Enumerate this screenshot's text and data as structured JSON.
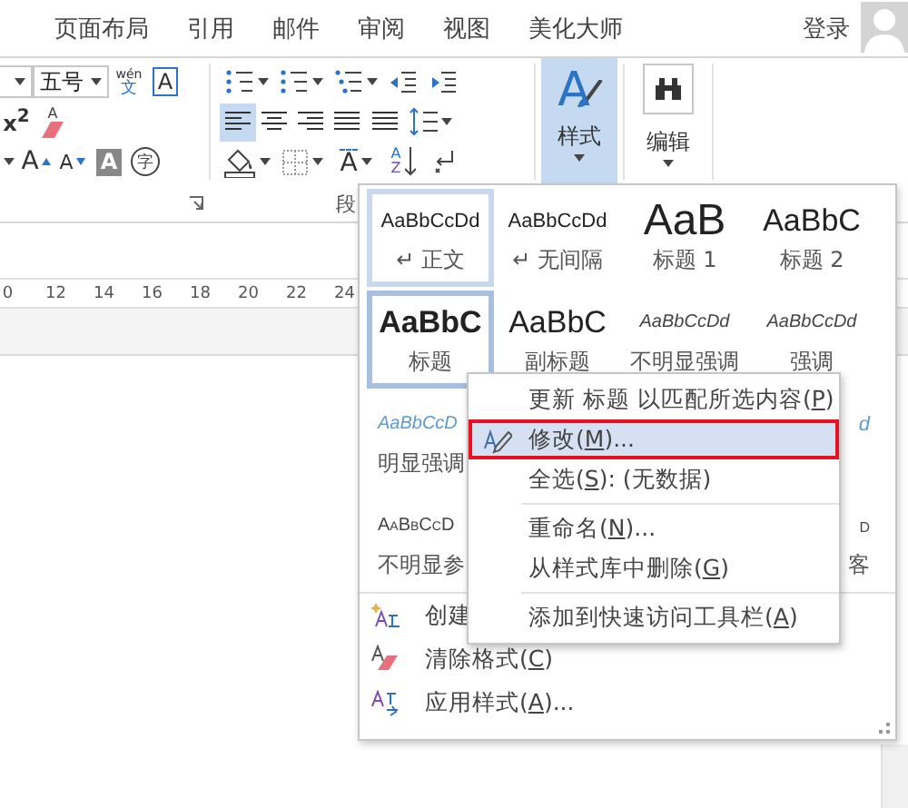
{
  "tabs": [
    {
      "label": "页面布局",
      "selected": false
    },
    {
      "label": "引用",
      "selected": false
    },
    {
      "label": "邮件",
      "selected": false
    },
    {
      "label": "审阅",
      "selected": false
    },
    {
      "label": "视图",
      "selected": false
    },
    {
      "label": "美化大师",
      "selected": false
    }
  ],
  "account": {
    "label": "登录"
  },
  "font_group": {
    "rows": [
      [
        {
          "kind": "combo-stub"
        },
        {
          "kind": "combo",
          "value": "五号"
        },
        {
          "kind": "phonetic",
          "top": "wén",
          "glyph": "文"
        },
        {
          "kind": "char-border",
          "glyph": "A"
        }
      ],
      [
        {
          "kind": "superscript",
          "glyph": "x$^{2}$"
        },
        {
          "kind": "clear-format",
          "glyph": "A"
        }
      ],
      [
        {
          "kind": "caret-stub"
        },
        {
          "kind": "grow-font",
          "glyph": "A"
        },
        {
          "kind": "shrink-font",
          "glyph": "A"
        },
        {
          "kind": "char-shading",
          "glyph": "A"
        },
        {
          "kind": "enclose",
          "glyph": "字"
        }
      ]
    ]
  },
  "paragraph_group": {
    "rows": [
      [
        {
          "kind": "bullets"
        },
        {
          "kind": "numbering"
        },
        {
          "kind": "multilevel"
        },
        {
          "kind": "decrease-indent"
        },
        {
          "kind": "increase-indent"
        }
      ],
      [
        {
          "kind": "align-left",
          "selected": true
        },
        {
          "kind": "align-center",
          "selected": false
        },
        {
          "kind": "align-right",
          "selected": false
        },
        {
          "kind": "justify",
          "selected": false
        },
        {
          "kind": "distribute",
          "selected": false
        },
        {
          "kind": "line-spacing"
        }
      ],
      [
        {
          "kind": "shading"
        },
        {
          "kind": "borders"
        },
        {
          "kind": "asian-layout",
          "glyph": "A"
        },
        {
          "kind": "sort",
          "glyph": "A",
          "glyph2": "Z"
        },
        {
          "kind": "show-marks"
        }
      ]
    ],
    "label": "段"
  },
  "styles_button": {
    "label": "样式",
    "glyph": "A",
    "selected": true
  },
  "editing_button": {
    "label": "编辑"
  },
  "ruler": [
    "0",
    "12",
    "14",
    "16",
    "18",
    "20",
    "22",
    "24"
  ],
  "gallery": {
    "rows": [
      [
        {
          "kind": "normal",
          "preview": "AaBbCcDd",
          "label": "↵ 正文",
          "selected": false,
          "highlighted": true
        },
        {
          "kind": "normal",
          "preview": "AaBbCcDd",
          "label": "↵ 无间隔",
          "selected": false,
          "highlighted": false
        },
        {
          "kind": "heading1",
          "preview": "AaB",
          "label": "标题 1",
          "selected": false,
          "highlighted": false
        },
        {
          "kind": "heading2",
          "preview": "AaBbC",
          "label": "标题 2",
          "selected": false,
          "highlighted": false
        }
      ],
      [
        {
          "kind": "title",
          "preview": "AaBbC",
          "label": "标题",
          "selected": true,
          "highlighted": false
        },
        {
          "kind": "subtitle",
          "preview": "AaBbC",
          "label": "副标题",
          "selected": false,
          "highlighted": false
        },
        {
          "kind": "subtle",
          "preview": "AaBbCcDd",
          "label": "不明显强调",
          "selected": false,
          "highlighted": false
        },
        {
          "kind": "emphasis",
          "preview": "AaBbCcDd",
          "label": "强调",
          "selected": false,
          "highlighted": false
        }
      ],
      [
        {
          "kind": "intense",
          "preview": "AaBbCcD",
          "label": "明显强调",
          "selected": false,
          "highlighted": false
        },
        {
          "kind": "intense",
          "preview": "d",
          "selected": false,
          "highlighted": false
        }
      ],
      [
        {
          "kind": "smallcaps",
          "preview": "AaBbCcD",
          "label": "不明显参",
          "selected": false,
          "highlighted": false
        },
        {
          "kind": "smallcaps",
          "preview": "d",
          "label": "客",
          "selected": false,
          "highlighted": false
        }
      ]
    ],
    "commands": [
      {
        "kind": "new-style",
        "text": "创建"
      },
      {
        "kind": "clear",
        "text": "清除格式(",
        "key": "C",
        "after": ")"
      },
      {
        "kind": "apply",
        "text": "应用样式(",
        "key": "A",
        "after": ")..."
      }
    ]
  },
  "context_menu": [
    {
      "kind": "item",
      "text": "更新 标题 以匹配所选内容(",
      "key": "P",
      "after": ")",
      "selected": false
    },
    {
      "kind": "icon-item",
      "text": "修改(",
      "key": "M",
      "after": ")...",
      "selected": true
    },
    {
      "kind": "item",
      "text": "全选(",
      "key": "S",
      "after": "): (无数据)",
      "selected": false
    },
    {
      "kind": "separator"
    },
    {
      "kind": "item",
      "text": "重命名(",
      "key": "N",
      "after": ")...",
      "selected": false
    },
    {
      "kind": "item",
      "text": "从样式库中删除(",
      "key": "G",
      "after": ")",
      "selected": false
    },
    {
      "kind": "separator"
    },
    {
      "kind": "item",
      "text": "添加到快速访问工具栏(",
      "key": "A",
      "after": ")",
      "selected": false
    }
  ]
}
